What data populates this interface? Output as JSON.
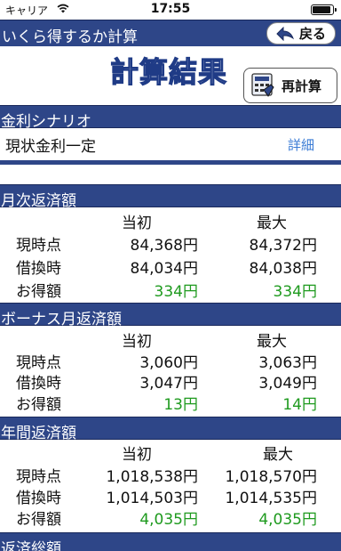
{
  "status_bar": {
    "carrier": "キャリア",
    "time": "17:55"
  },
  "nav": {
    "title": "いくら得するか計算",
    "back_label": "戻る"
  },
  "result_title": "計算結果",
  "recalc_label": "再計算",
  "scenario": {
    "section_title": "金利シナリオ",
    "value": "現状金利一定",
    "detail_link": "詳細"
  },
  "columns": {
    "initial": "当初",
    "max": "最大"
  },
  "sections": [
    {
      "title": "月次返済額",
      "rows": [
        {
          "label": "現時点",
          "initial": "84,368円",
          "max": "84,372円"
        },
        {
          "label": "借換時",
          "initial": "84,034円",
          "max": "84,038円"
        },
        {
          "label": "お得額",
          "initial": "334円",
          "max": "334円"
        }
      ]
    },
    {
      "title": "ボーナス月返済額",
      "rows": [
        {
          "label": "現時点",
          "initial": "3,060円",
          "max": "3,063円"
        },
        {
          "label": "借換時",
          "initial": "3,047円",
          "max": "3,049円"
        },
        {
          "label": "お得額",
          "initial": "13円",
          "max": "14円"
        }
      ]
    },
    {
      "title": "年間返済額",
      "rows": [
        {
          "label": "現時点",
          "initial": "1,018,538円",
          "max": "1,018,570円"
        },
        {
          "label": "借換時",
          "initial": "1,014,503円",
          "max": "1,014,535円"
        },
        {
          "label": "お得額",
          "initial": "4,035円",
          "max": "4,035円"
        }
      ]
    },
    {
      "title": "返済総額"
    }
  ],
  "colors": {
    "header_bg": "#2e4688",
    "savings_green": "#1e9a1e",
    "link_blue": "#3a7bd5"
  }
}
